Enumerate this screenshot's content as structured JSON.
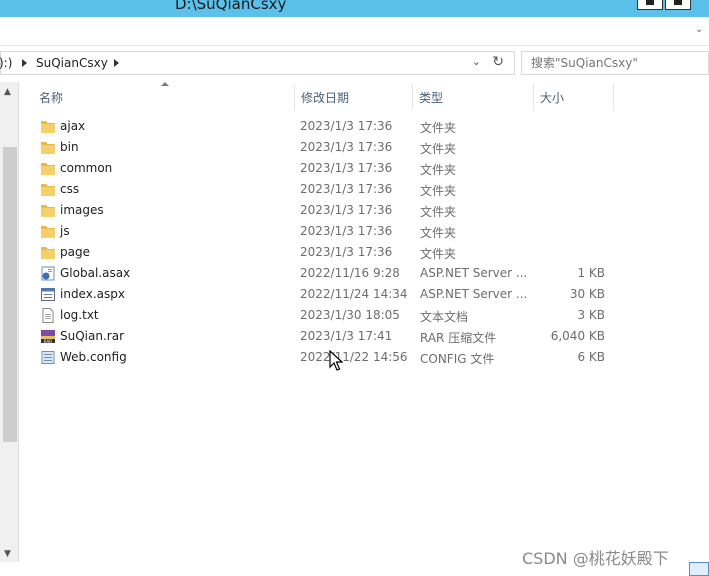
{
  "window": {
    "title": "D:\\SuQianCsxy"
  },
  "address": {
    "drive_fragment": "):)",
    "folder": "SuQianCsxy"
  },
  "search": {
    "placeholder": "搜索\"SuQianCsxy\""
  },
  "columns": {
    "name": "名称",
    "date": "修改日期",
    "type": "类型",
    "size": "大小"
  },
  "files": [
    {
      "name": "ajax",
      "date": "2023/1/3 17:36",
      "type": "文件夹",
      "size": "",
      "icon": "folder-icon"
    },
    {
      "name": "bin",
      "date": "2023/1/3 17:36",
      "type": "文件夹",
      "size": "",
      "icon": "folder-icon"
    },
    {
      "name": "common",
      "date": "2023/1/3 17:36",
      "type": "文件夹",
      "size": "",
      "icon": "folder-icon"
    },
    {
      "name": "css",
      "date": "2023/1/3 17:36",
      "type": "文件夹",
      "size": "",
      "icon": "folder-icon"
    },
    {
      "name": "images",
      "date": "2023/1/3 17:36",
      "type": "文件夹",
      "size": "",
      "icon": "folder-icon"
    },
    {
      "name": "js",
      "date": "2023/1/3 17:36",
      "type": "文件夹",
      "size": "",
      "icon": "folder-icon"
    },
    {
      "name": "page",
      "date": "2023/1/3 17:36",
      "type": "文件夹",
      "size": "",
      "icon": "folder-icon"
    },
    {
      "name": "Global.asax",
      "date": "2022/11/16 9:28",
      "type": "ASP.NET Server ...",
      "size": "1 KB",
      "icon": "asax-file-icon"
    },
    {
      "name": "index.aspx",
      "date": "2022/11/24 14:34",
      "type": "ASP.NET Server ...",
      "size": "30 KB",
      "icon": "aspx-file-icon"
    },
    {
      "name": "log.txt",
      "date": "2023/1/30 18:05",
      "type": "文本文档",
      "size": "3 KB",
      "icon": "text-file-icon"
    },
    {
      "name": "SuQian.rar",
      "date": "2023/1/3 17:41",
      "type": "RAR 压缩文件",
      "size": "6,040 KB",
      "icon": "rar-file-icon"
    },
    {
      "name": "Web.config",
      "date": "2022/11/22 14:56",
      "type": "CONFIG 文件",
      "size": "6 KB",
      "icon": "config-file-icon"
    }
  ],
  "watermark": "CSDN @桃花妖殿下",
  "colors": {
    "titlebar": "#5bc0ea",
    "folder": "#e8b84a",
    "header_text": "#4c607a"
  }
}
